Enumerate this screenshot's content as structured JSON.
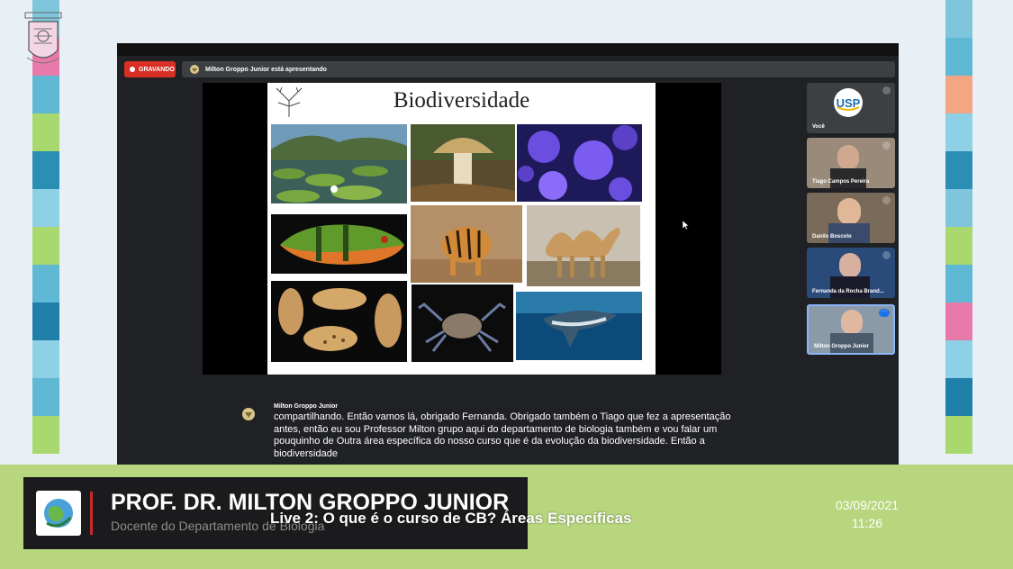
{
  "recording": {
    "label": "GRAVANDO"
  },
  "presenting": {
    "text": "Milton Groppo Junior está apresentando"
  },
  "slide": {
    "title": "Biodiversidade"
  },
  "participants": [
    {
      "name": "Você"
    },
    {
      "name": "Tiago Campos Pereira"
    },
    {
      "name": "Danilo Boscolo"
    },
    {
      "name": "Fernanda da Rocha Brand..."
    },
    {
      "name": "Milton Groppo Junior"
    }
  ],
  "caption": {
    "speaker": "Milton Groppo Junior",
    "text": "compartilhando. Então vamos lá, obrigado Fernanda. Obrigado também o Tiago que fez a apresentação antes, então eu sou Professor Milton grupo aqui do departamento de biologia também e vou falar um pouquinho de Outra área específica do nosso curso que é da evolução da biodiversidade. Então a biodiversidade"
  },
  "lower_third": {
    "name": "PROF. DR. MILTON GROPPO JUNIOR",
    "role": "Docente do Departamento de Biologia"
  },
  "live_title": "Live 2: O que é o curso de CB? Áreas Específicas",
  "date": "03/09/2021",
  "time": "11:26",
  "icons": [
    "crest-logo",
    "recording-dot-icon",
    "presenter-avatar-icon",
    "tree-of-life-icon",
    "mic-icon",
    "more-options-icon",
    "cursor-icon",
    "globe-logo"
  ],
  "colors": {
    "accent_red": "#d93025",
    "band_green": "#b7d67e",
    "active_blue": "#8ab4f8"
  }
}
